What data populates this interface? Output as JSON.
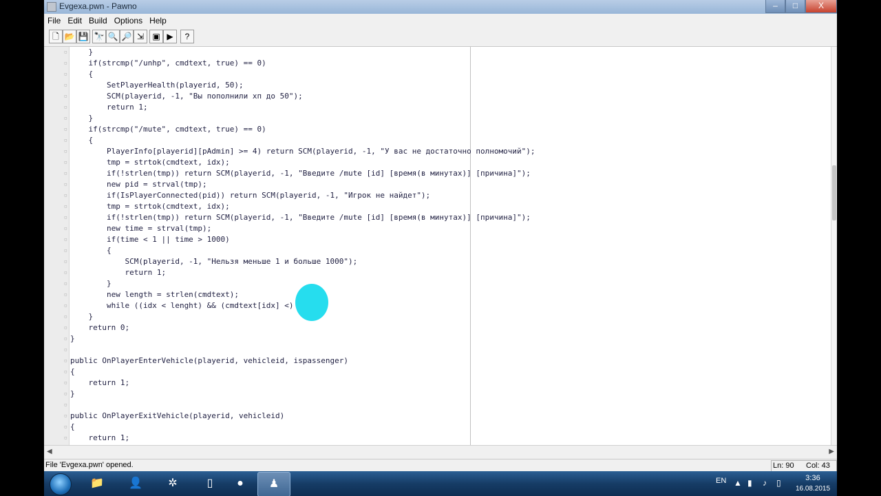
{
  "window": {
    "title": "Evgexa.pwn - Pawno",
    "controls": {
      "minimize": "–",
      "maximize": "□",
      "close": "X"
    }
  },
  "menu": [
    "File",
    "Edit",
    "Build",
    "Options",
    "Help"
  ],
  "toolbar": [
    {
      "name": "new-file-icon",
      "glyph": "🗋"
    },
    {
      "name": "open-folder-icon",
      "glyph": "📂"
    },
    {
      "name": "save-icon",
      "glyph": "💾"
    },
    {
      "name": "binoculars-icon",
      "glyph": "🔭"
    },
    {
      "name": "find-next-icon",
      "glyph": "🔍"
    },
    {
      "name": "replace-icon",
      "glyph": "🔎"
    },
    {
      "name": "goto-icon",
      "glyph": "⇲"
    },
    {
      "name": "compile-icon",
      "glyph": "▣"
    },
    {
      "name": "run-icon",
      "glyph": "▶"
    },
    {
      "name": "help-icon",
      "glyph": "?"
    }
  ],
  "editor": {
    "lines": [
      "    }",
      "    if(strcmp(\"/unhp\", cmdtext, true) == 0)",
      "    {",
      "        SetPlayerHealth(playerid, 50);",
      "        SCM(playerid, -1, \"Вы пополнили хп до 50\");",
      "        return 1;",
      "    }",
      "    if(strcmp(\"/mute\", cmdtext, true) == 0)",
      "    {",
      "        PlayerInfo[playerid][pAdmin] >= 4) return SCM(playerid, -1, \"У вас не достаточно полномочий\");",
      "        tmp = strtok(cmdtext, idx);",
      "        if(!strlen(tmp)) return SCM(playerid, -1, \"Введите /mute [id] [время(в минутах)] [причина]\");",
      "        new pid = strval(tmp);",
      "        if(IsPlayerConnected(pid)) return SCM(playerid, -1, \"Игрок не найдет\");",
      "        tmp = strtok(cmdtext, idx);",
      "        if(!strlen(tmp)) return SCM(playerid, -1, \"Введите /mute [id] [время(в минутах)] [причина]\");",
      "        new time = strval(tmp);",
      "        if(time < 1 || time > 1000)",
      "        {",
      "            SCM(playerid, -1, \"Нельзя меньше 1 и больше 1000\");",
      "            return 1;",
      "        }",
      "        new length = strlen(cmdtext);",
      "        while ((idx < lenght) && (cmdtext[idx] <)",
      "    }",
      "    return 0;",
      "}",
      "",
      "public OnPlayerEnterVehicle(playerid, vehicleid, ispassenger)",
      "{",
      "    return 1;",
      "}",
      "",
      "public OnPlayerExitVehicle(playerid, vehicleid)",
      "{",
      "    return 1;"
    ]
  },
  "status": {
    "message": "File 'Evgexa.pwn' opened.",
    "line": "Ln: 90",
    "column": "Col: 43"
  },
  "taskbar": {
    "apps": [
      {
        "name": "file-explorer-icon",
        "glyph": "📁",
        "active": false
      },
      {
        "name": "game-character-icon",
        "glyph": "👤",
        "active": false
      },
      {
        "name": "photoshop-icon",
        "glyph": "✲",
        "active": false
      },
      {
        "name": "document-icon",
        "glyph": "▯",
        "active": false
      },
      {
        "name": "recorder-icon",
        "glyph": "●",
        "active": false
      },
      {
        "name": "pawno-icon",
        "glyph": "♟",
        "active": true
      }
    ],
    "language": "EN",
    "time": "3:36",
    "date": "16.08.2015"
  }
}
